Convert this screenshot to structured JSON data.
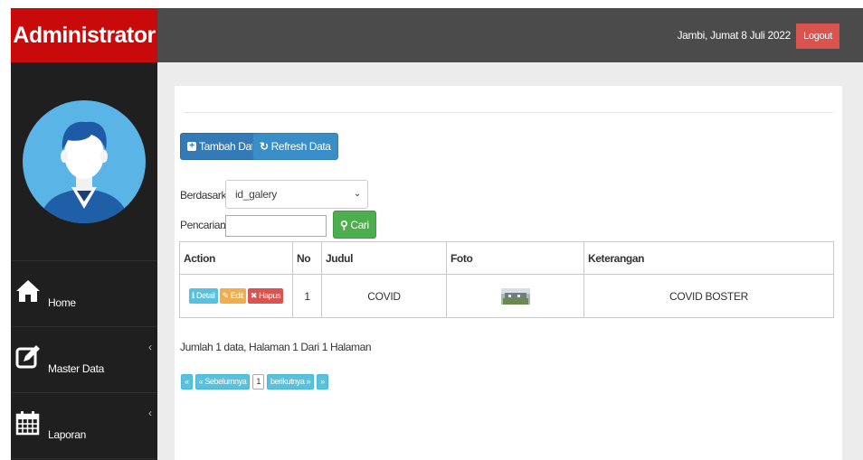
{
  "brand": "Administrator",
  "topbar": {
    "date": "Jambi, Jumat 8 Juli 2022",
    "logout": "Logout"
  },
  "sidebar": {
    "items": [
      {
        "label": "Home",
        "icon": "home-icon",
        "has_chevron": false
      },
      {
        "label": "Master Data",
        "icon": "edit-icon",
        "has_chevron": true
      },
      {
        "label": "Laporan",
        "icon": "calendar-icon",
        "has_chevron": true
      }
    ],
    "chevron": "‹"
  },
  "toolbar": {
    "add_label": "Tambah Data",
    "refresh_label": "Refresh Data"
  },
  "filter": {
    "by_label": "Berdasarkan:",
    "by_value": "id_galery",
    "search_label": "Pencarian",
    "search_value": "",
    "search_button": "Cari"
  },
  "table": {
    "headers": [
      "Action",
      "No",
      "Judul",
      "Foto",
      "Keterangan"
    ],
    "rows": [
      {
        "no": "1",
        "judul": "COVID",
        "keterangan": "COVID BOSTER",
        "actions": {
          "detail": "Detail",
          "edit": "Edit",
          "hapus": "Hapus"
        }
      }
    ]
  },
  "summary": "Jumlah 1 data, Halaman 1 Dari 1 Halaman",
  "pagination": {
    "first": "«",
    "prev": "« Sebelumnya",
    "page": "1",
    "next": "berikutnya »",
    "last": "»"
  },
  "colors": {
    "brand": "#c90a0a",
    "sidebar": "#1f1f1f",
    "topbar": "#4b4b4b",
    "primary": "#337ab7",
    "success": "#4cae4c",
    "info": "#5bc0de",
    "warning": "#f0ad4e",
    "danger": "#d9534f"
  }
}
